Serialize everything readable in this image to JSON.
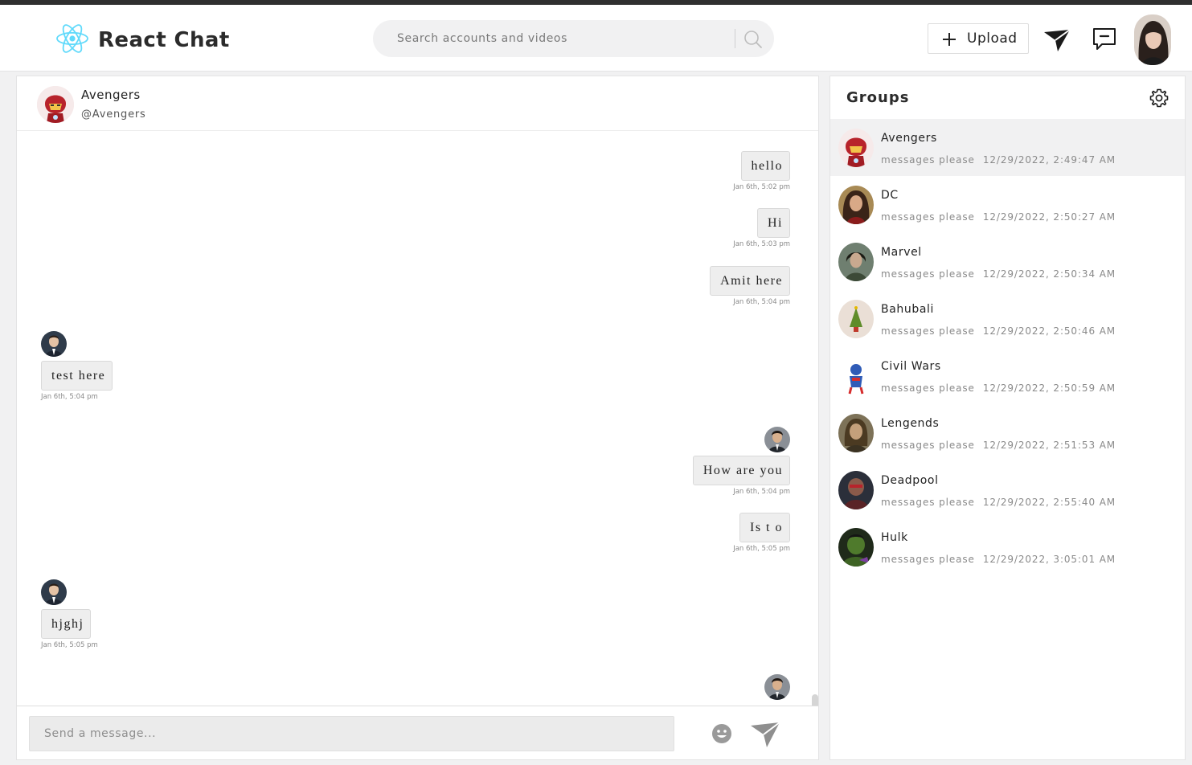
{
  "app": {
    "title": "React Chat"
  },
  "colors": {
    "accent": "#61dafb",
    "panel_bg": "#ffffff",
    "page_bg": "#f1f1f2",
    "bubble_bg": "#eeeeee"
  },
  "header": {
    "search_placeholder": "Search accounts and videos",
    "upload_label": "Upload",
    "icons": [
      "react-logo-icon",
      "search-icon",
      "plus-icon",
      "paper-plane-icon",
      "message-icon",
      "profile-avatar"
    ]
  },
  "chat": {
    "name": "Avengers",
    "handle": "@Avengers",
    "messages": [
      {
        "side": "right",
        "text": "hello",
        "time": "Jan 6th, 5:02 pm"
      },
      {
        "side": "right",
        "text": "Hi",
        "time": "Jan 6th, 5:03 pm"
      },
      {
        "side": "right",
        "text": "Amit here",
        "time": "Jan 6th, 5:04 pm"
      },
      {
        "side": "left",
        "text": "test here",
        "time": "Jan 6th, 5:04 pm"
      },
      {
        "side": "right",
        "text": "How are you",
        "time": "Jan 6th, 5:04 pm"
      },
      {
        "side": "right",
        "text": "Is t o",
        "time": "Jan 6th, 5:05 pm"
      },
      {
        "side": "left",
        "text": "hjghj",
        "time": "Jan 6th, 5:05 pm"
      }
    ],
    "compose_placeholder": "Send a message..."
  },
  "groups": {
    "title": "Groups",
    "items": [
      {
        "name": "Avengers",
        "preview": "messages please",
        "time": "12/29/2022, 2:49:47 AM",
        "active": true
      },
      {
        "name": "DC",
        "preview": "messages please",
        "time": "12/29/2022, 2:50:27 AM"
      },
      {
        "name": "Marvel",
        "preview": "messages please",
        "time": "12/29/2022, 2:50:34 AM"
      },
      {
        "name": "Bahubali",
        "preview": "messages please",
        "time": "12/29/2022, 2:50:46 AM"
      },
      {
        "name": "Civil Wars",
        "preview": "messages please",
        "time": "12/29/2022, 2:50:59 AM"
      },
      {
        "name": "Lengends",
        "preview": "messages please",
        "time": "12/29/2022, 2:51:53 AM"
      },
      {
        "name": "Deadpool",
        "preview": "messages please",
        "time": "12/29/2022, 2:55:40 AM"
      },
      {
        "name": "Hulk",
        "preview": "messages please",
        "time": "12/29/2022, 3:05:01 AM"
      }
    ]
  }
}
